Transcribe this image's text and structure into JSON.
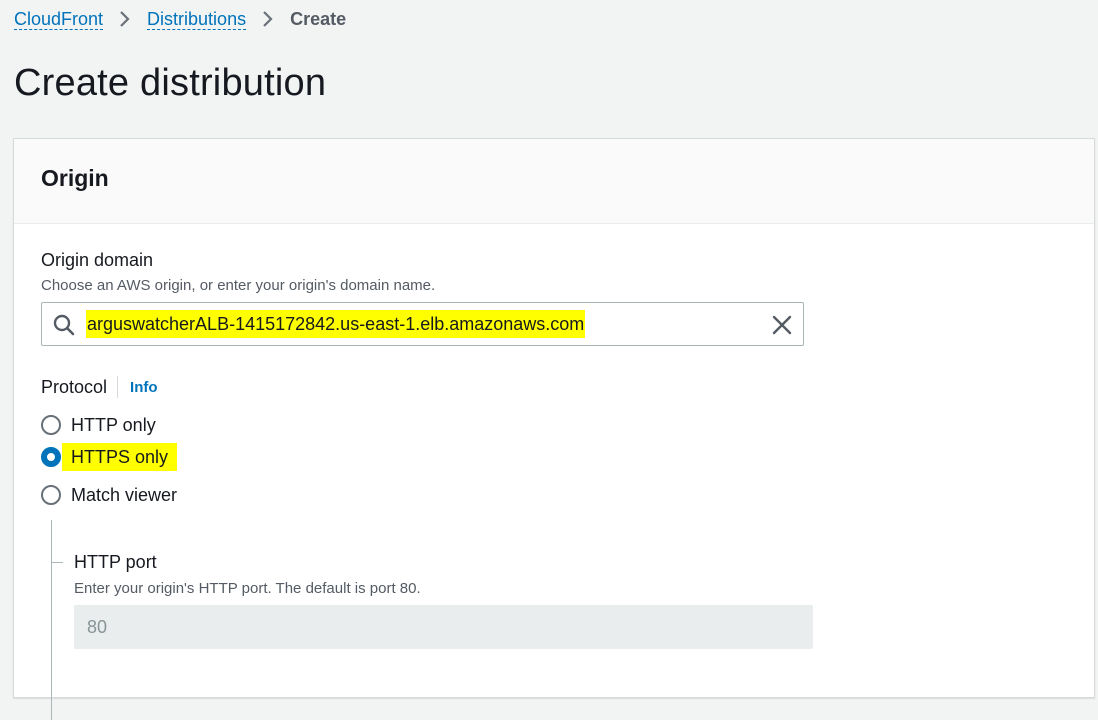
{
  "breadcrumb": {
    "items": [
      "CloudFront",
      "Distributions"
    ],
    "current": "Create"
  },
  "page": {
    "title": "Create distribution"
  },
  "origin": {
    "section_title": "Origin",
    "domain_label": "Origin domain",
    "domain_description": "Choose an AWS origin, or enter your origin's domain name.",
    "domain_value": "arguswatcherALB-1415172842.us-east-1.elb.amazonaws.com",
    "protocol_label": "Protocol",
    "info_link": "Info",
    "protocol_options": [
      {
        "label": "HTTP only",
        "selected": false
      },
      {
        "label": "HTTPS only",
        "selected": true
      },
      {
        "label": "Match viewer",
        "selected": false
      }
    ],
    "http_port_label": "HTTP port",
    "http_port_description": "Enter your origin's HTTP port. The default is port 80.",
    "http_port_value": "80"
  },
  "colors": {
    "link": "#0073bb",
    "highlight": "#ffff00",
    "radio_selected": "#0073bb"
  }
}
